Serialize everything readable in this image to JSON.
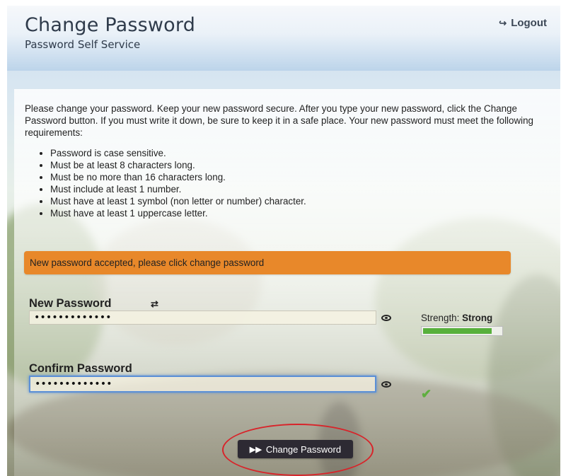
{
  "header": {
    "title": "Change Password",
    "subtitle": "Password Self Service",
    "logout_label": "Logout",
    "logout_icon": "logout-icon"
  },
  "instructions": {
    "intro": "Please change your password. Keep your new password secure. After you type your new password, click the Change Password button. If you must write it down, be sure to keep it in a safe place. Your new password must meet the following requirements:",
    "requirements": [
      "Password is case sensitive.",
      "Must be at least 8 characters long.",
      "Must be no more than 16 characters long.",
      "Must include at least 1 number.",
      "Must have at least 1 symbol (non letter or number) character.",
      "Must have at least 1 uppercase letter."
    ]
  },
  "alert": {
    "message": "New password accepted, please click change password",
    "color": "#e8882a"
  },
  "new_password": {
    "label": "New Password",
    "value": "•••••••••••••",
    "refresh_icon": "refresh-icon",
    "show_icon": "eye-icon"
  },
  "strength": {
    "label": "Strength:",
    "value": "Strong",
    "fill_percent": 88,
    "color": "#58b03c"
  },
  "confirm_password": {
    "label": "Confirm Password",
    "value": "•••••••••••••",
    "show_icon": "eye-icon",
    "match_icon": "checkmark-icon",
    "match_color": "#5fae3f"
  },
  "submit": {
    "label": "Change Password",
    "icon": "fast-forward-icon"
  }
}
